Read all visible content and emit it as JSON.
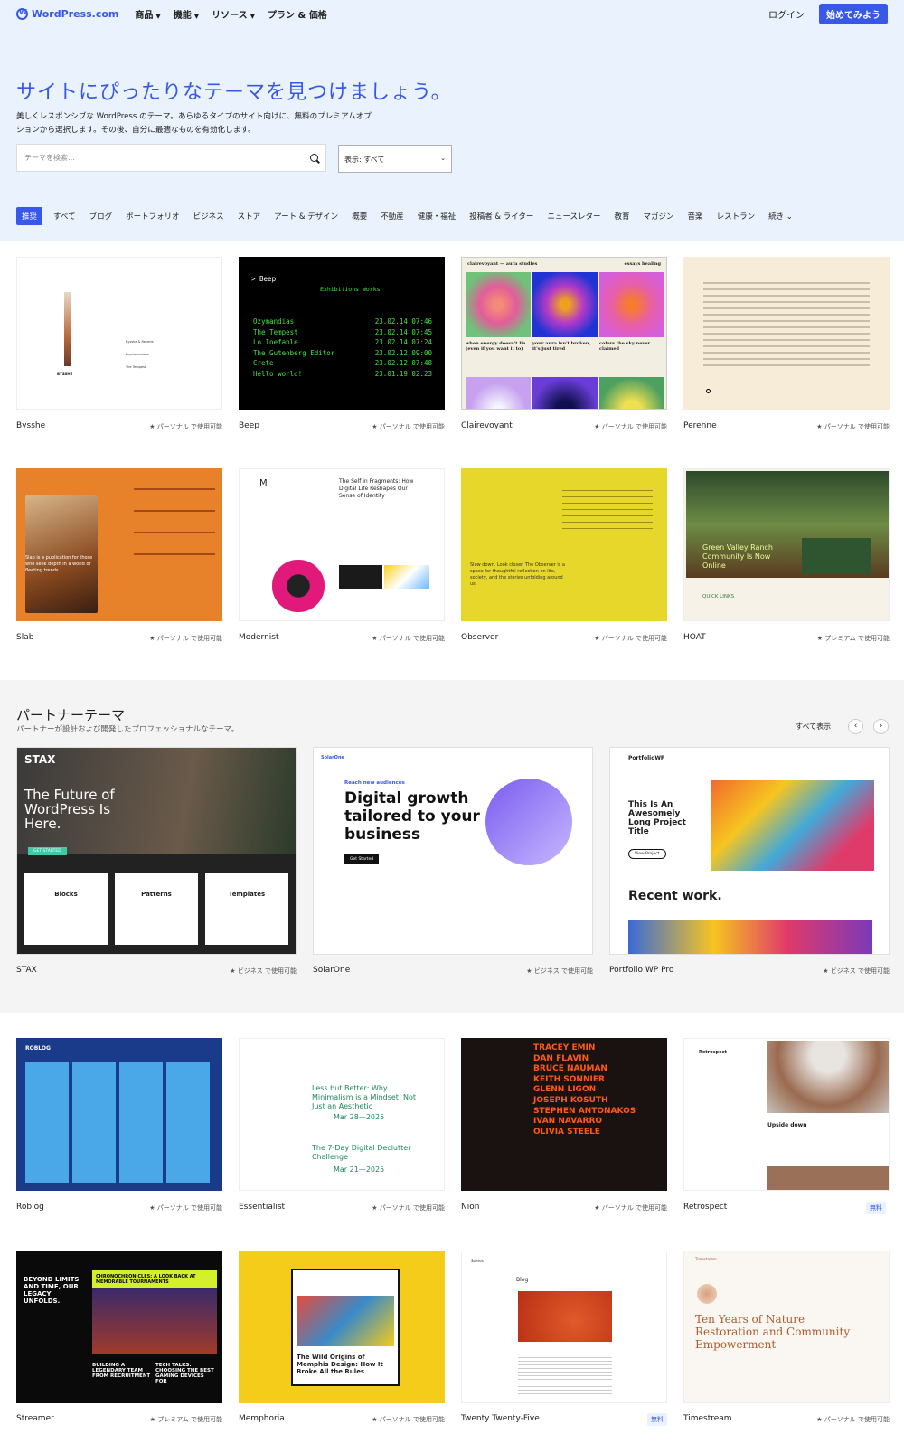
{
  "header": {
    "logo_text": "WordPress.com",
    "nav": [
      "商品",
      "機能",
      "リソース",
      "プラン & 価格"
    ],
    "login": "ログイン",
    "start": "始めてみよう"
  },
  "hero": {
    "title": "サイトにぴったりなテーマを見つけましょう。",
    "desc": "美しくレスポンシブな WordPress のテーマ。あらゆるタイプのサイト向けに、無料のプレミアムオプションから選択します。その後、自分に最適なものを有効化します。",
    "search_placeholder": "テーマを検索…",
    "view_label": "表示: すべて"
  },
  "categories": [
    "推奨",
    "すべて",
    "ブログ",
    "ポートフォリオ",
    "ビジネス",
    "ストア",
    "アート & デザイン",
    "概要",
    "不動産",
    "健康・福祉",
    "投稿者 & ライター",
    "ニュースレター",
    "教育",
    "マガジン",
    "音楽",
    "レストラン",
    "続き"
  ],
  "badges": {
    "personal": "★ パーソナル で使用可能",
    "premium": "★ プレミアム で使用可能",
    "business": "★ ビジネス で使用可能",
    "free": "無料"
  },
  "row1": [
    {
      "name": "Bysshe",
      "badge": "★ パーソナル で使用可能"
    },
    {
      "name": "Beep",
      "badge": "★ パーソナル で使用可能"
    },
    {
      "name": "Clairevoyant",
      "badge": "★ パーソナル で使用可能"
    },
    {
      "name": "Perenne",
      "badge": "★ パーソナル で使用可能"
    }
  ],
  "row2": [
    {
      "name": "Slab",
      "badge": "★ パーソナル で使用可能"
    },
    {
      "name": "Modernist",
      "badge": "★ パーソナル で使用可能"
    },
    {
      "name": "Observer",
      "badge": "★ パーソナル で使用可能"
    },
    {
      "name": "HOAT",
      "badge": "★ プレミアム で使用可能"
    }
  ],
  "partner": {
    "title": "パートナーテーマ",
    "subtitle": "パートナーが設計および開発したプロフェッショナルなテーマ。",
    "see_all": "すべて表示",
    "prev": "‹",
    "next": "›",
    "cards": [
      {
        "name": "STAX",
        "badge": "★ ビジネス で使用可能"
      },
      {
        "name": "SolarOne",
        "badge": "★ ビジネス で使用可能"
      },
      {
        "name": "Portfolio WP Pro",
        "badge": "★ ビジネス で使用可能"
      }
    ]
  },
  "row3": [
    {
      "name": "Roblog",
      "badge": "★ パーソナル で使用可能"
    },
    {
      "name": "Essentialist",
      "badge": "★ パーソナル で使用可能"
    },
    {
      "name": "Nion",
      "badge": "★ パーソナル で使用可能"
    },
    {
      "name": "Retrospect",
      "badge": "無料"
    }
  ],
  "row4": [
    {
      "name": "Streamer",
      "badge": "★ プレミアム で使用可能"
    },
    {
      "name": "Memphoria",
      "badge": "★ パーソナル で使用可能"
    },
    {
      "name": "Twenty Twenty-Five",
      "badge": "無料"
    },
    {
      "name": "Timestream",
      "badge": "★ パーソナル で使用可能"
    }
  ],
  "thumbs": {
    "bysshe": {
      "label": "BYSSHE",
      "items": [
        "Bysshe & Reverie",
        "Zephorumiano",
        "The Tempest"
      ]
    },
    "beep": {
      "title": "> Beep",
      "nav": "Exhibitions   Works",
      "posts": [
        [
          "Ozymandias",
          "23.02.14 07:46"
        ],
        [
          "The Tempest",
          "23.02.14 07:45"
        ],
        [
          "Lo Inefable",
          "23.02.14 07:24"
        ],
        [
          "The Gutenberg Editor",
          "23.02.12 09:00"
        ],
        [
          "Crete",
          "23.02.12 07:48"
        ],
        [
          "Hello world!",
          "23.01.19 02:23"
        ]
      ]
    },
    "clairevoyant": {
      "brand": "clairevoyant — aura studies",
      "nav": "essays  healing",
      "captions": [
        "when energy doesn't lie (even if you want it to)",
        "your aura isn't broken, it's just tired",
        "colors the sky never claimed"
      ]
    },
    "modernist": {
      "logo": "M",
      "headline": "The Self in Fragments: How Digital Life Reshapes Our Sense of Identity"
    },
    "observer": {
      "text": "Slow down. Look closer. The Observer is a space for thoughtful reflection on life, society, and the stories unfolding around us."
    },
    "hoat": {
      "headline": "Green Valley Ranch Community Is Now Online",
      "links": "QUICK LINKS"
    },
    "slab": {
      "quote": "Slab is a publication for those who seek depth in a world of fleeting trends."
    },
    "stax": {
      "brand": "STAX",
      "headline": "The Future of WordPress Is Here.",
      "cols": [
        "Blocks",
        "Patterns",
        "Templates"
      ],
      "cta": "GET STARTED"
    },
    "solarone": {
      "brand": "SolarOne",
      "kicker": "Reach new audiences",
      "headline": "Digital growth tailored to your business",
      "cta": "Get Started"
    },
    "portfoliowp": {
      "brand": "PortfolioWP",
      "headline": "This Is An Awesomely Long Project Title",
      "recent": "Recent work.",
      "cta": "View Project"
    },
    "roblog": {
      "brand": "ROBLOG"
    },
    "essentialist": {
      "post1": "Less but Better: Why Minimalism is a Mindset, Not Just an Aesthetic",
      "date1": "Mar 28—2025",
      "post2": "The 7-Day Digital Declutter Challenge",
      "date2": "Mar 21—2025"
    },
    "nion": {
      "names": [
        "TRACEY EMIN",
        "DAN FLAVIN",
        "BRUCE NAUMAN",
        "KEITH SONNIER",
        "GLENN LIGON",
        "JOSEPH KOSUTH",
        "STEPHEN ANTONAKOS",
        "IVAN NAVARRO",
        "OLIVIA STEELE"
      ]
    },
    "retrospect": {
      "brand": "Retrospect",
      "post": "Upside down"
    },
    "streamer": {
      "headline": "BEYOND LIMITS AND TIME, OUR LEGACY UNFOLDS.",
      "feature": "CHRONOCHRONICLES: A LOOK BACK AT MEMORABLE TOURNAMENTS",
      "card1": "BUILDING A LEGENDARY TEAM FROM RECRUITMENT",
      "card2": "TECH TALKS: CHOOSING THE BEST GAMING DEVICES FOR"
    },
    "memphoria": {
      "headline": "The Wild Origins of Memphis Design: How It Broke All the Rules"
    },
    "tt5": {
      "brand": "Stories",
      "heading": "Blog"
    },
    "timestream": {
      "brand": "Timestream",
      "headline": "Ten Years of Nature Restoration and Community Empowerment"
    }
  }
}
